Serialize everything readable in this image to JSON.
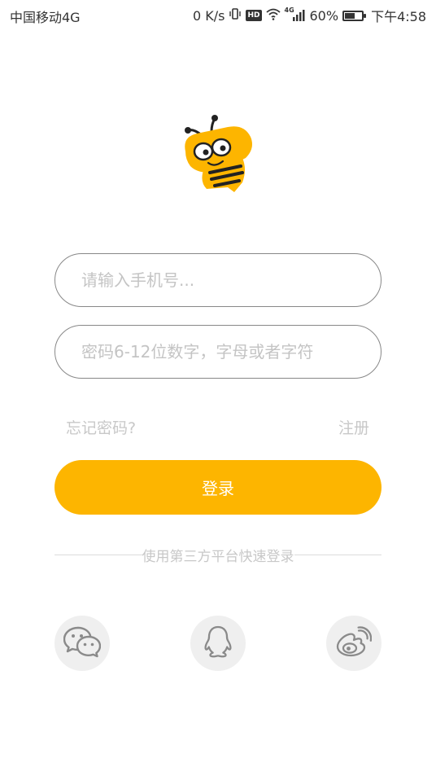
{
  "status_bar": {
    "carrier": "中国移动4G",
    "speed": "0 K/s",
    "hd": "HD",
    "network": "4G",
    "battery_percent": "60%",
    "battery_level": 0.6,
    "time": "下午4:58"
  },
  "login": {
    "phone_placeholder": "请输入手机号...",
    "password_placeholder": "密码6-12位数字，字母或者字符",
    "forgot_label": "忘记密码?",
    "register_label": "注册",
    "login_label": "登录",
    "third_party_label": "使用第三方平台快速登录"
  },
  "social": {
    "items": [
      "wechat-icon",
      "qq-icon",
      "weibo-icon"
    ]
  },
  "colors": {
    "accent": "#fdb500",
    "placeholder": "#c4c4c4",
    "link": "#c8c8c8",
    "social_bg": "#efefef",
    "icon": "#8a8a8a"
  }
}
